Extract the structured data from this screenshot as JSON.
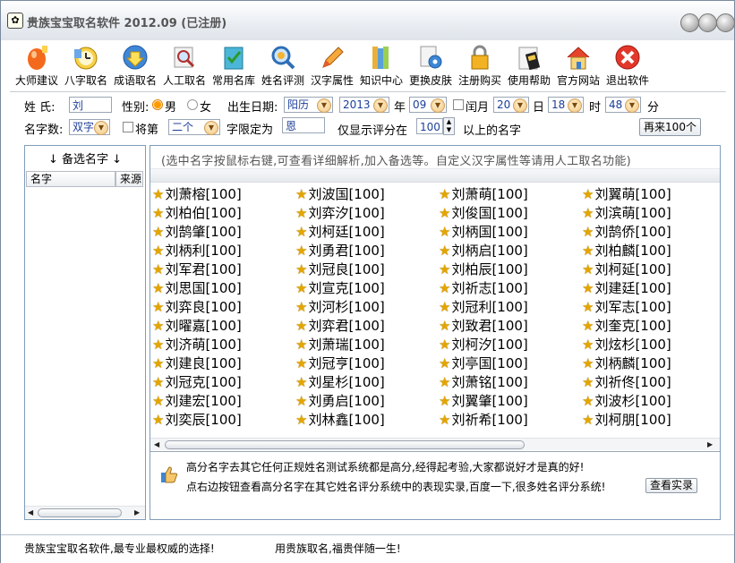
{
  "window": {
    "title": "贵族宝宝取名软件 2012.09 (已注册)"
  },
  "toolbar": {
    "items": [
      {
        "label": "大师建议",
        "icon": "egg-icon"
      },
      {
        "label": "八字取名",
        "icon": "clock-icon"
      },
      {
        "label": "成语取名",
        "icon": "download-arrow-icon"
      },
      {
        "label": "人工取名",
        "icon": "magnifier-icon"
      },
      {
        "label": "常用名库",
        "icon": "book-check-icon"
      },
      {
        "label": "姓名评测",
        "icon": "magnifier-plus-icon"
      },
      {
        "label": "汉字属性",
        "icon": "pencil-icon"
      },
      {
        "label": "知识中心",
        "icon": "books-icon"
      },
      {
        "label": "更换皮肤",
        "icon": "gear-paper-icon"
      },
      {
        "label": "注册购买",
        "icon": "lock-icon"
      },
      {
        "label": "使用帮助",
        "icon": "film-help-icon"
      },
      {
        "label": "官方网站",
        "icon": "house-icon"
      },
      {
        "label": "退出软件",
        "icon": "close-icon"
      }
    ]
  },
  "form": {
    "surname_label": "姓  氏:",
    "surname_value": "刘",
    "gender_label": "性别:",
    "gender_male": "男",
    "gender_female": "女",
    "gender_selected": "男",
    "birth_label": "出生日期:",
    "calendar_value": "阳历",
    "year_value": "2013",
    "year_label": "年",
    "month_value": "09",
    "leap_label": "闰月",
    "day_value": "20",
    "day_label": "日",
    "hour_value": "18",
    "hour_label": "时",
    "minute_value": "48",
    "minute_label": "分",
    "namecount_label": "名字数:",
    "namecount_value": "双字",
    "position_check_label": "将第",
    "position_value": "二个",
    "fixed_char_label": "字限定为",
    "fixed_char_value": "恩",
    "score_label_pre": "仅显示评分在",
    "score_value": "100",
    "score_label_post": "以上的名字",
    "more_button": "再来100个"
  },
  "left_panel": {
    "title": "↓ 备选名字 ↓",
    "col_name": "名字",
    "col_source": "来源"
  },
  "main": {
    "hint": "(选中名字按鼠标右键,可查看详细解析,加入备选等。自定义汉字属性等请用人工取名功能)",
    "names": [
      [
        "刘萧榕[100]",
        "刘柏伯[100]",
        "刘鹄肇[100]",
        "刘柄利[100]",
        "刘军君[100]",
        "刘思国[100]",
        "刘弈良[100]",
        "刘曜嘉[100]",
        "刘济萌[100]",
        "刘建良[100]",
        "刘冠克[100]",
        "刘建宏[100]",
        "刘奕辰[100]"
      ],
      [
        "刘波国[100]",
        "刘弈汐[100]",
        "刘柯廷[100]",
        "刘勇君[100]",
        "刘冠良[100]",
        "刘宣克[100]",
        "刘河杉[100]",
        "刘弈君[100]",
        "刘萧瑞[100]",
        "刘冠亨[100]",
        "刘星杉[100]",
        "刘勇启[100]",
        "刘林鑫[100]"
      ],
      [
        "刘萧萌[100]",
        "刘俊国[100]",
        "刘柄国[100]",
        "刘柄启[100]",
        "刘柏辰[100]",
        "刘祈志[100]",
        "刘冠利[100]",
        "刘致君[100]",
        "刘柯汐[100]",
        "刘亭国[100]",
        "刘萧铭[100]",
        "刘翼肇[100]",
        "刘祈希[100]"
      ],
      [
        "刘翼萌[100]",
        "刘滨萌[100]",
        "刘鹄侨[100]",
        "刘柏麟[100]",
        "刘柯延[100]",
        "刘建廷[100]",
        "刘军志[100]",
        "刘奎克[100]",
        "刘炫杉[100]",
        "刘柄麟[100]",
        "刘祈佟[100]",
        "刘波杉[100]",
        "刘柯朋[100]"
      ]
    ],
    "tip_line1": "高分名字去其它任何正规姓名测试系统都是高分,经得起考验,大家都说好才是真的好!",
    "tip_line2": "点右边按钮查看高分名字在其它姓名评分系统中的表现实录,百度一下,很多姓名评分系统!",
    "view_button": "查看实录"
  },
  "status": {
    "left": "贵族宝宝取名软件,最专业最权威的选择!",
    "right": "用贵族取名,福贵伴随一生!"
  }
}
